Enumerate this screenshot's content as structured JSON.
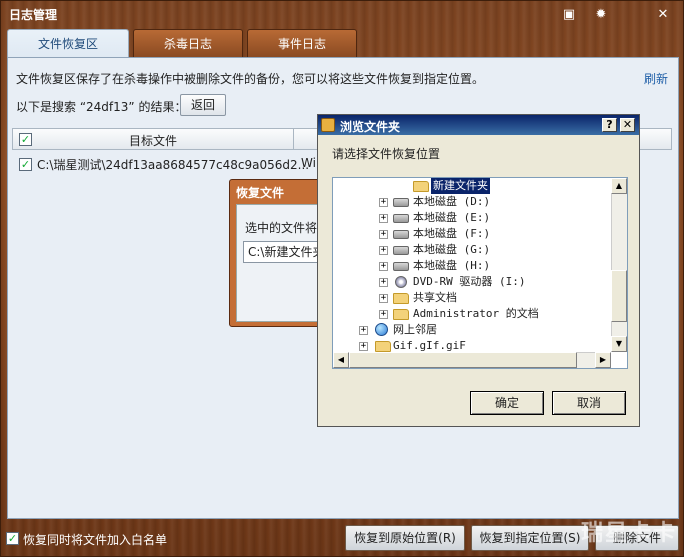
{
  "window": {
    "title": "日志管理",
    "controls": [
      "menu-icon",
      "gear-icon",
      "close-icon"
    ]
  },
  "tabs": [
    {
      "label": "文件恢复区",
      "active": true
    },
    {
      "label": "杀毒日志",
      "active": false
    },
    {
      "label": "事件日志",
      "active": false
    }
  ],
  "panel": {
    "description": "文件恢复区保存了在杀毒操作中被删除文件的备份，您可以将这些文件恢复到指定位置。",
    "refresh_label": "刷新",
    "search_result": "以下是搜索 “24df13” 的结果：",
    "back_label": "返回",
    "table": {
      "column_target": "目标文件",
      "row_path": "C:\\瑞星测试\\24df13aa8684577c48c9a056d2...",
      "row_second": "Wi"
    }
  },
  "recover_dialog": {
    "title": "恢复文件",
    "label": "选中的文件将",
    "path_value": "C:\\新建文件夹"
  },
  "browse_dialog": {
    "title": "浏览文件夹",
    "help_label": "?",
    "close_label": "✕",
    "prompt": "请选择文件恢复位置",
    "tree": [
      {
        "label": "新建文件夹",
        "icon": "folder-icon",
        "selected": true
      },
      {
        "label": "本地磁盘  (D:)",
        "icon": "drive-icon"
      },
      {
        "label": "本地磁盘  (E:)",
        "icon": "drive-icon"
      },
      {
        "label": "本地磁盘  (F:)",
        "icon": "drive-icon"
      },
      {
        "label": "本地磁盘  (G:)",
        "icon": "drive-icon"
      },
      {
        "label": "本地磁盘  (H:)",
        "icon": "drive-icon"
      },
      {
        "label": "DVD-RW 驱动器  (I:)",
        "icon": "cd-drive-icon"
      },
      {
        "label": "共享文档",
        "icon": "folder-icon"
      },
      {
        "label": "Administrator 的文档",
        "icon": "folder-icon"
      },
      {
        "label": "网上邻居",
        "icon": "network-icon"
      },
      {
        "label": "Gif.gIf.giF",
        "icon": "folder-icon"
      }
    ],
    "ok_label": "确定",
    "cancel_label": "取消"
  },
  "bottom": {
    "whitelist_label": "恢复同时将文件加入白名单",
    "restore_original": "恢复到原始位置(R)",
    "restore_specified": "恢复到指定位置(S)",
    "delete_label": "删除文件",
    "watermark": "瑞星卡卡"
  }
}
